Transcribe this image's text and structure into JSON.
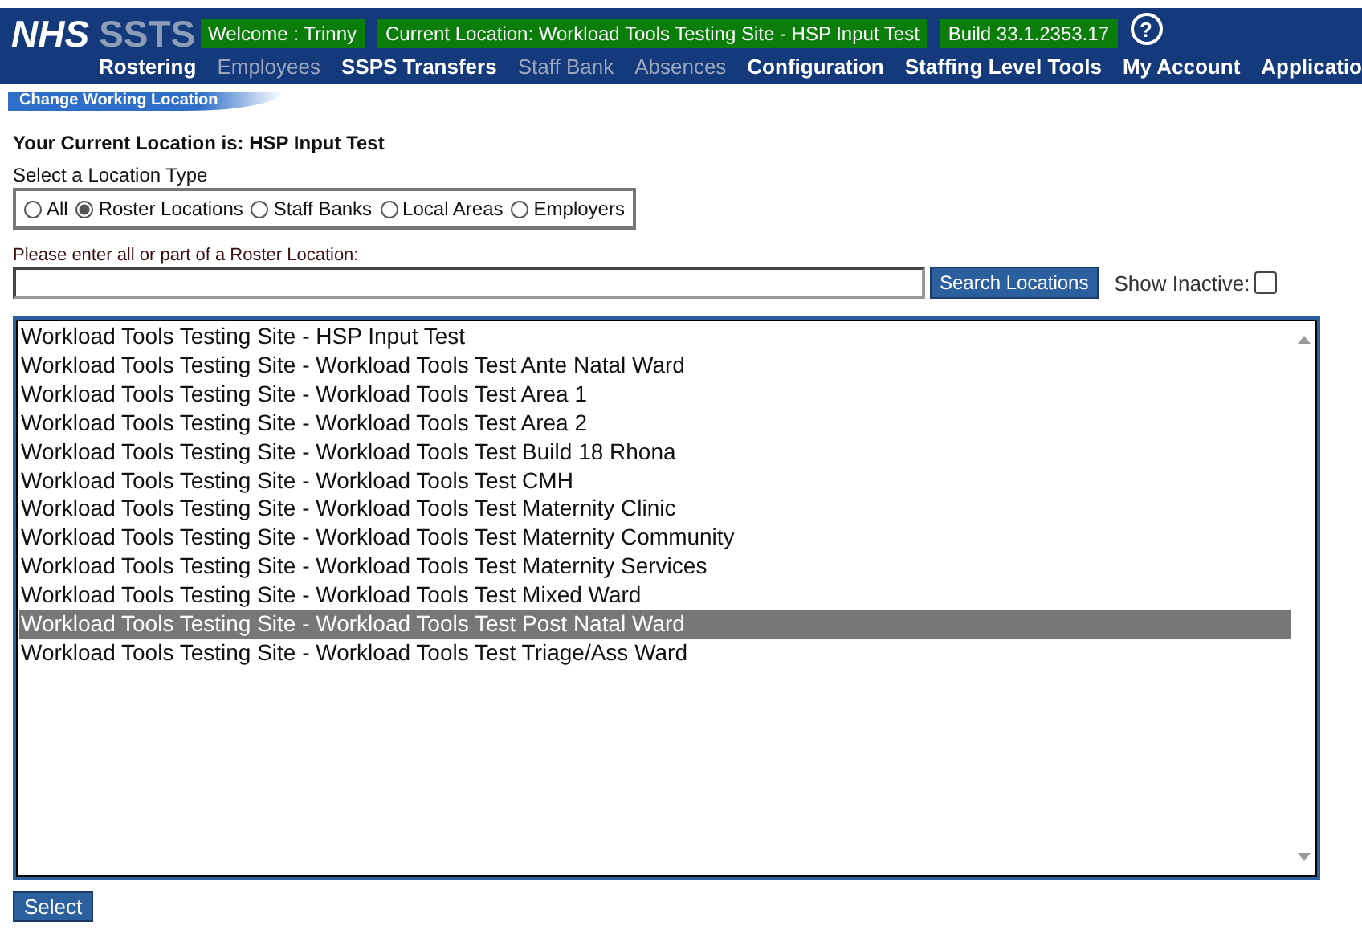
{
  "header": {
    "logo_left": "NHS",
    "logo_right": "SSTS",
    "welcome": "Welcome : Trinny",
    "current_location": "Current Location: Workload Tools Testing Site - HSP Input Test",
    "build": "Build 33.1.2353.17",
    "help": "?"
  },
  "nav": [
    {
      "label": "Rostering",
      "disabled": false
    },
    {
      "label": "Employees",
      "disabled": true
    },
    {
      "label": "SSPS Transfers",
      "disabled": false
    },
    {
      "label": "Staff Bank",
      "disabled": true
    },
    {
      "label": "Absences",
      "disabled": true
    },
    {
      "label": "Configuration",
      "disabled": false
    },
    {
      "label": "Staffing Level Tools",
      "disabled": false
    },
    {
      "label": "My Account",
      "disabled": false
    },
    {
      "label": "Applicatio",
      "disabled": false
    }
  ],
  "subtab": "Change Working Location",
  "current_location_heading": "Your Current Location is: HSP Input Test",
  "location_type_label": "Select a Location Type",
  "location_types": [
    {
      "label": "All",
      "selected": false
    },
    {
      "label": "Roster Locations",
      "selected": true
    },
    {
      "label": "Staff Banks",
      "selected": false
    },
    {
      "label": "Local Areas",
      "selected": false
    },
    {
      "label": "Employers",
      "selected": false
    }
  ],
  "search_label": "Please enter all or part of a Roster Location:",
  "search_button": "Search Locations",
  "show_inactive": {
    "label": "Show Inactive:",
    "checked": false
  },
  "locations": [
    {
      "label": "Workload Tools Testing Site - HSP Input Test",
      "selected": false
    },
    {
      "label": "Workload Tools Testing Site - Workload Tools Test Ante Natal Ward",
      "selected": false
    },
    {
      "label": "Workload Tools Testing Site - Workload Tools Test Area 1",
      "selected": false
    },
    {
      "label": "Workload Tools Testing Site - Workload Tools Test Area 2",
      "selected": false
    },
    {
      "label": "Workload Tools Testing Site - Workload Tools Test Build 18 Rhona",
      "selected": false
    },
    {
      "label": "Workload Tools Testing Site - Workload Tools Test CMH",
      "selected": false
    },
    {
      "label": "Workload Tools Testing Site - Workload Tools Test Maternity Clinic",
      "selected": false
    },
    {
      "label": "Workload Tools Testing Site - Workload Tools Test Maternity Community",
      "selected": false
    },
    {
      "label": "Workload Tools Testing Site - Workload Tools Test Maternity Services",
      "selected": false
    },
    {
      "label": "Workload Tools Testing Site - Workload Tools Test Mixed Ward",
      "selected": false
    },
    {
      "label": "Workload Tools Testing Site - Workload Tools Test Post Natal Ward",
      "selected": true
    },
    {
      "label": "Workload Tools Testing Site - Workload Tools Test Triage/Ass Ward",
      "selected": false
    }
  ],
  "select_button": "Select"
}
